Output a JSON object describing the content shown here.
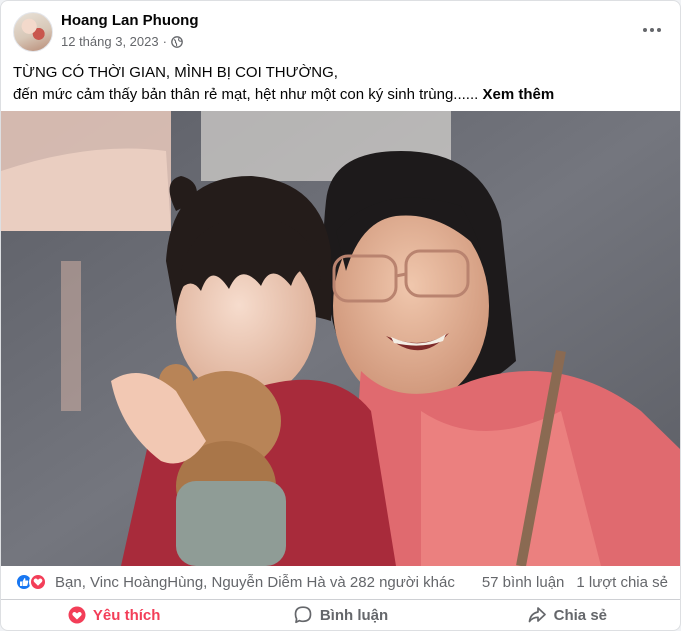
{
  "post": {
    "author": "Hoang Lan Phuong",
    "date": "12 tháng 3, 2023",
    "separator": "·",
    "privacy_icon": "globe-icon",
    "text_line1": "TỪNG CÓ THỜI GIAN, MÌNH BỊ COI THƯỜNG,",
    "text_line2": "đến mức cảm thấy bản thân rẻ mạt, hệt như một con ký sinh trùng......",
    "see_more": "Xem thêm"
  },
  "stats": {
    "reaction_icons": [
      "like-icon",
      "love-icon"
    ],
    "reactions_text": "Bạn, Vinc HoàngHùng, Nguyễn Diễm Hà và 282 người khác",
    "comments": "57 bình luận",
    "shares": "1 lượt chia sẻ"
  },
  "actions": {
    "like": "Yêu thích",
    "comment": "Bình luận",
    "share": "Chia sẻ"
  },
  "colors": {
    "like_blue": "#1877f2",
    "love_red": "#f33e58",
    "secondary_text": "#65676b"
  }
}
